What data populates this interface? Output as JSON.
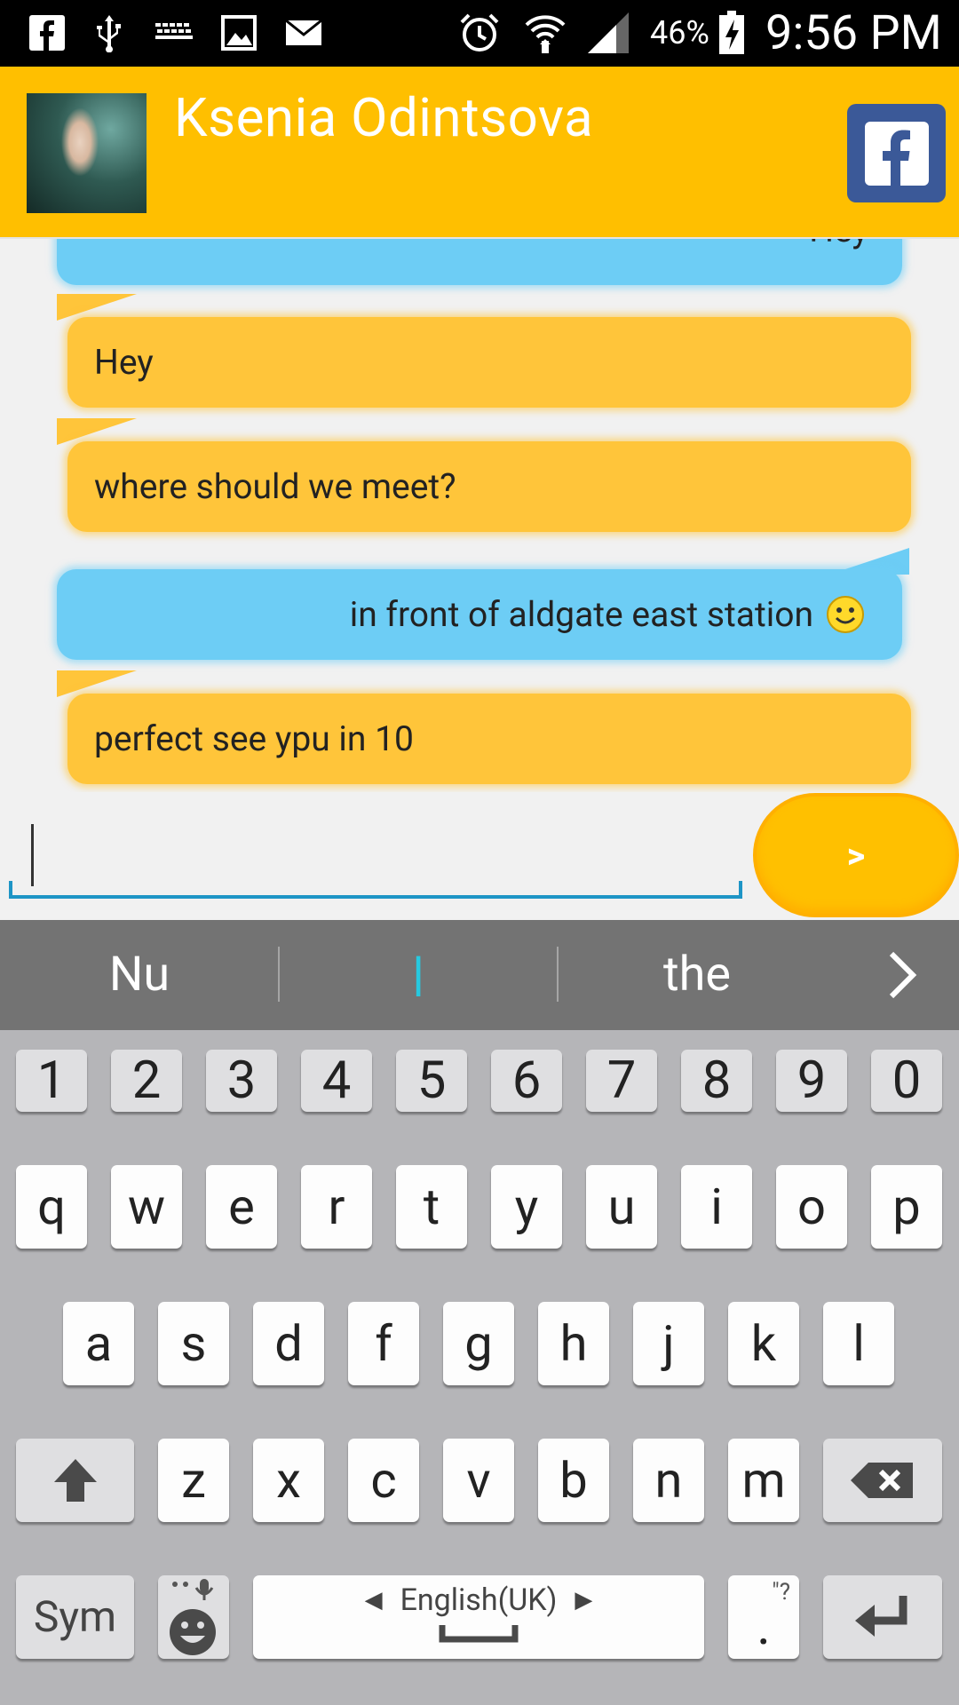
{
  "status_bar": {
    "left_icons": [
      "facebook-icon",
      "usb-icon",
      "keyboard-icon",
      "image-icon",
      "mail-icon"
    ],
    "right_icons": [
      "alarm-icon",
      "wifi-icon",
      "signal-icon"
    ],
    "battery": "46%",
    "time": "9:56 PM"
  },
  "header": {
    "contact_name": "Ksenia Odintsova",
    "facebook_label": "f",
    "color": "#ffbf00"
  },
  "chat": {
    "messages": [
      {
        "text": "Hey",
        "direction": "out"
      },
      {
        "text": "Hey",
        "direction": "in"
      },
      {
        "text": "where should we meet?",
        "direction": "in"
      },
      {
        "text": "in front of aldgate east station",
        "direction": "out",
        "emoji": "smile"
      },
      {
        "text": "perfect see ypu in 10",
        "direction": "in"
      }
    ],
    "colors": {
      "incoming": "#ffc53a",
      "outgoing": "#6dcdf5"
    }
  },
  "composer": {
    "value": "",
    "send_label": ">"
  },
  "keyboard": {
    "suggestions": [
      "Nu",
      "|",
      "the"
    ],
    "number_row": [
      "1",
      "2",
      "3",
      "4",
      "5",
      "6",
      "7",
      "8",
      "9",
      "0"
    ],
    "row1": [
      "q",
      "w",
      "e",
      "r",
      "t",
      "y",
      "u",
      "i",
      "o",
      "p"
    ],
    "row2": [
      "a",
      "s",
      "d",
      "f",
      "g",
      "h",
      "j",
      "k",
      "l"
    ],
    "row3": [
      "z",
      "x",
      "c",
      "v",
      "b",
      "n",
      "m"
    ],
    "sym_label": "Sym",
    "language": "English(UK)",
    "period": "."
  }
}
